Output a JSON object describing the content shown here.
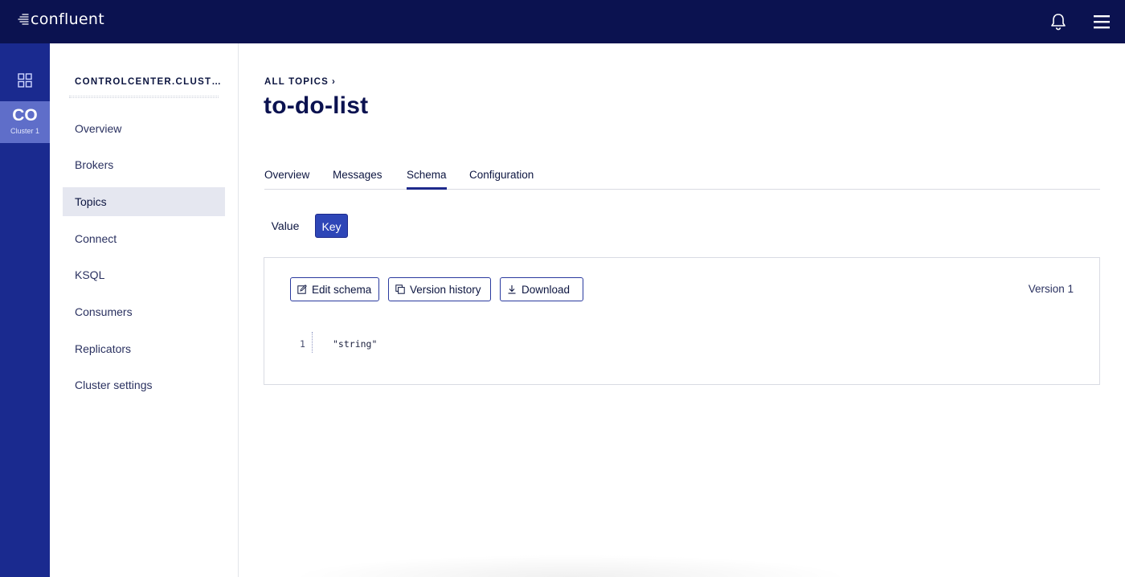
{
  "topbar": {
    "brand": "confluent",
    "bell_icon": "bell-icon",
    "menu_icon": "hamburger-menu-icon"
  },
  "rail": {
    "grid_icon": "grid-icon",
    "cluster_abbr": "CO",
    "cluster_name": "Cluster 1"
  },
  "sidebar": {
    "cluster_title": "CONTROLCENTER.CLUST…",
    "items": [
      {
        "label": "Overview"
      },
      {
        "label": "Brokers"
      },
      {
        "label": "Topics"
      },
      {
        "label": "Connect"
      },
      {
        "label": "KSQL"
      },
      {
        "label": "Consumers"
      },
      {
        "label": "Replicators"
      },
      {
        "label": "Cluster settings"
      }
    ],
    "active": "Topics"
  },
  "main": {
    "breadcrumb": "ALL TOPICS",
    "title": "to-do-list",
    "tabs": [
      {
        "label": "Overview"
      },
      {
        "label": "Messages"
      },
      {
        "label": "Schema"
      },
      {
        "label": "Configuration"
      }
    ],
    "active_tab": "Schema",
    "subtabs": {
      "value": "Value",
      "key": "Key",
      "active": "Key"
    },
    "panel": {
      "edit_label": "Edit schema",
      "history_label": "Version history",
      "download_label": "Download",
      "version_label": "Version 1",
      "code_line_number": "1",
      "code_text": "\"string\""
    }
  },
  "colors": {
    "topbar": "#0b1250",
    "rail": "#1a2a8f",
    "accent": "#2e46b7"
  }
}
